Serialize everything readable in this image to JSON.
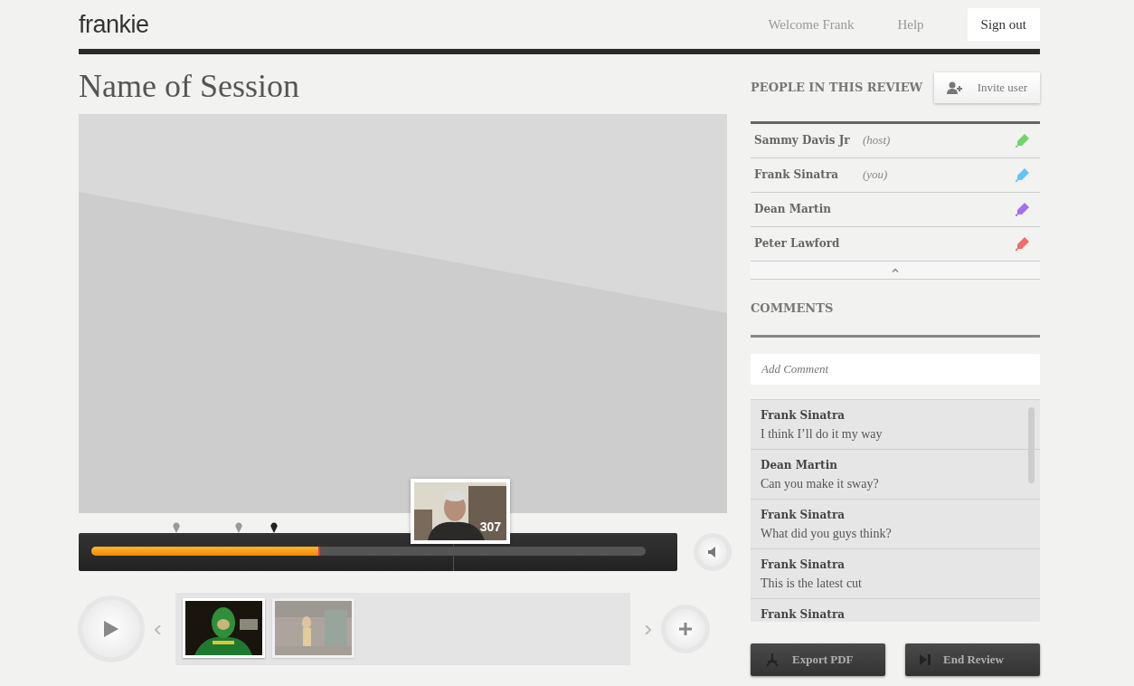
{
  "header": {
    "logo": "frankie",
    "links": [
      {
        "label": "Welcome Frank",
        "kind": "link"
      },
      {
        "label": "Help",
        "kind": "link"
      },
      {
        "label": "Sign out",
        "kind": "button"
      }
    ]
  },
  "session": {
    "title": "Name of Session"
  },
  "player": {
    "progress": {
      "level": 0.41
    },
    "markers": [
      {
        "selected": false
      },
      {
        "selected": false
      },
      {
        "selected": true
      }
    ],
    "preview": {
      "frame": "307"
    },
    "clips": [
      {
        "selected": true
      },
      {
        "selected": false
      }
    ]
  },
  "people": {
    "heading": "PEOPLE IN THIS REVIEW",
    "invite": "Invite user",
    "members": [
      {
        "name": "Sammy Davis Jr",
        "role": "(host)",
        "color": "#6fd66a"
      },
      {
        "name": "Frank Sinatra",
        "role": "(you)",
        "color": "#62c3f5"
      },
      {
        "name": "Dean Martin",
        "color": "#a56ff0"
      },
      {
        "name": "Peter Lawford",
        "color": "#f26a6a"
      }
    ]
  },
  "comments": {
    "heading": "COMMENTS",
    "placeholder": "Add Comment",
    "items": [
      {
        "author": "Frank Sinatra",
        "text": "I think I’ll do it my way"
      },
      {
        "author": "Dean Martin",
        "text": "Can you make it sway?"
      },
      {
        "author": "Frank Sinatra",
        "text": "What did you guys think?"
      },
      {
        "author": "Frank Sinatra",
        "text": "This is the latest cut"
      },
      {
        "author": "Frank Sinatra"
      }
    ]
  },
  "actions": [
    {
      "label": "Export PDF",
      "kind": "export"
    },
    {
      "label": "End Review",
      "kind": "end"
    }
  ]
}
